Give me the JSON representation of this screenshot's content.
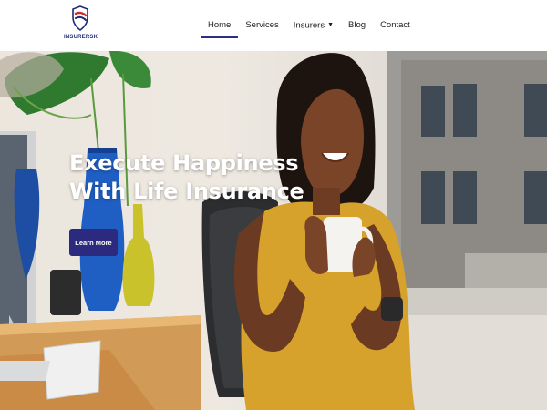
{
  "brand": {
    "name": "INSURERSK",
    "primary_color": "#2b2a7e",
    "accent_color": "#d62828"
  },
  "nav": {
    "items": [
      {
        "label": "Home",
        "active": true
      },
      {
        "label": "Services"
      },
      {
        "label": "Insurers",
        "has_dropdown": true
      },
      {
        "label": "Blog"
      },
      {
        "label": "Contact"
      }
    ],
    "dropdown_icon": "chevron-down-icon"
  },
  "hero": {
    "headline_line1": "Execute Happiness",
    "headline_line2": "With Life Insurance",
    "cta_label": "Learn More",
    "image": "smiling-woman-holding-coffee-mug-at-office-desk"
  }
}
